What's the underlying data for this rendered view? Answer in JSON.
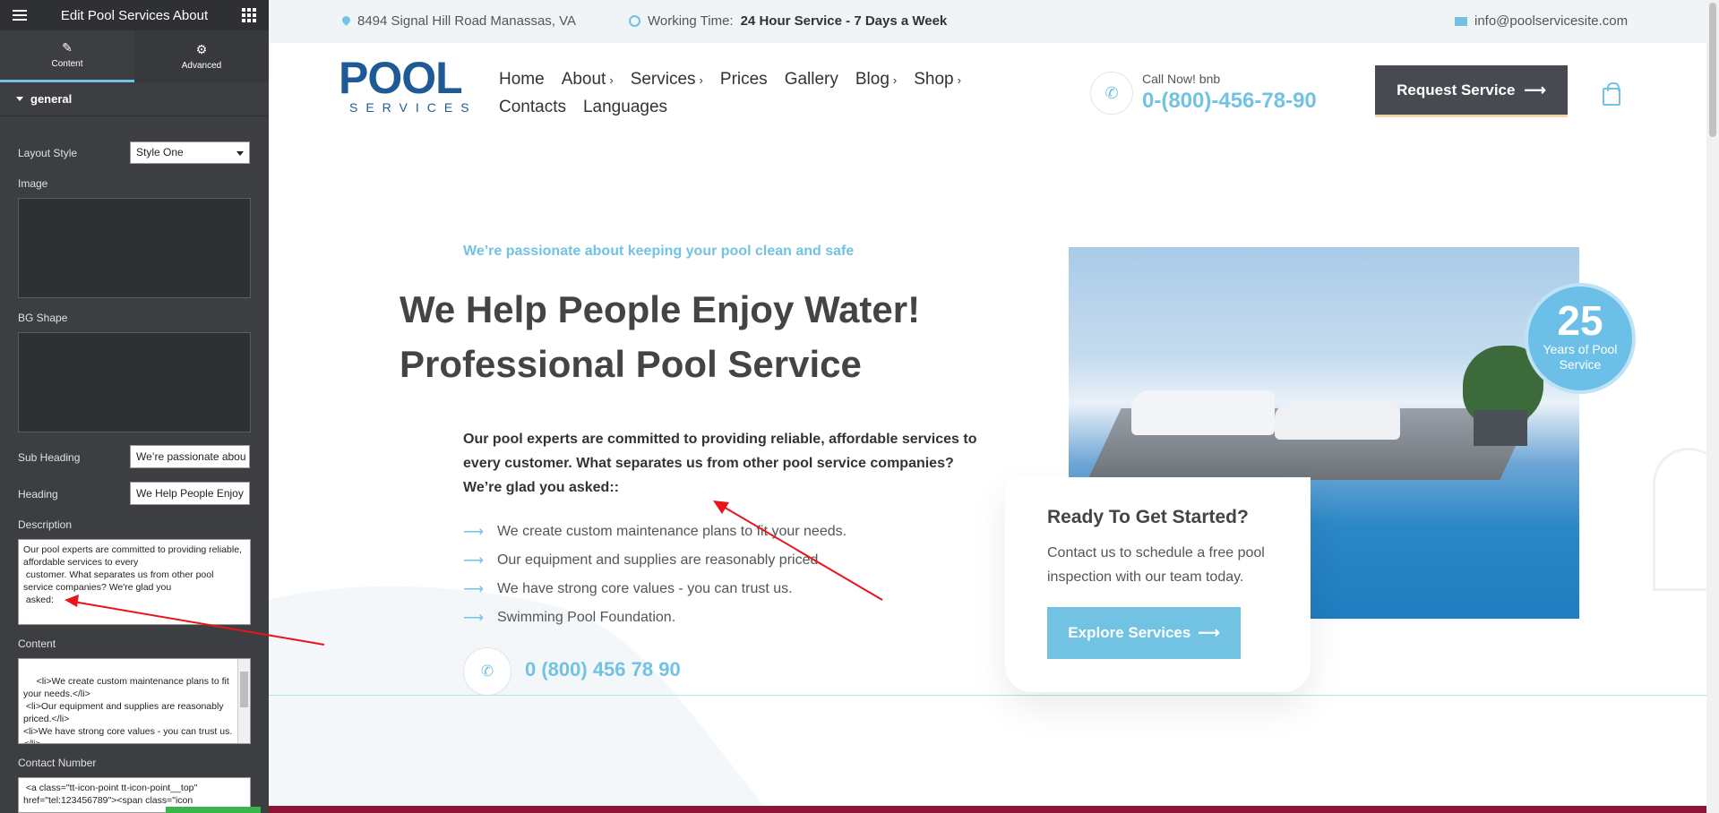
{
  "editor": {
    "title": "Edit Pool Services About",
    "tabs": [
      {
        "label": "Content",
        "icon": "pencil-icon"
      },
      {
        "label": "Advanced",
        "icon": "gear-icon"
      }
    ],
    "section": "general",
    "layout_style": {
      "label": "Layout Style",
      "value": "Style One"
    },
    "image_label": "Image",
    "bg_shape_label": "BG Shape",
    "sub_heading": {
      "label": "Sub Heading",
      "value": "We’re passionate abou"
    },
    "heading": {
      "label": "Heading",
      "value": "We Help People Enjoy"
    },
    "description": {
      "label": "Description",
      "value": "Our pool experts are committed to providing reliable, affordable services to every\n customer. What separates us from other pool service companies? We're glad you\n asked:"
    },
    "content": {
      "label": "Content",
      "value": " <li>We create custom maintenance plans to fit your needs.</li>\n <li>Our equipment and supplies are reasonably priced.</li>\n<li>We have strong core values - you can trust us.</li>\n <li>Swimming Pool Foundation.</li>"
    },
    "contact_number": {
      "label": "Contact Number",
      "value": " <a class=\"tt-icon-point tt-icon-point__top\" href=\"tel:123456789\"><span class=\"icon"
    }
  },
  "topbar": {
    "address": "8494 Signal Hill Road Manassas, VA",
    "working_label": "Working Time:",
    "working_value": "24 Hour Service - 7 Days a Week",
    "email": "info@poolservicesite.com"
  },
  "logo": {
    "main": "POOL",
    "sub": "SERVICES"
  },
  "nav": {
    "row1": [
      {
        "label": "Home",
        "chevron": ""
      },
      {
        "label": "About",
        "chevron": "›"
      },
      {
        "label": "Services",
        "chevron": "›"
      },
      {
        "label": "Prices",
        "chevron": ""
      },
      {
        "label": "Gallery",
        "chevron": ""
      },
      {
        "label": "Blog",
        "chevron": "›"
      },
      {
        "label": "Shop",
        "chevron": "›"
      }
    ],
    "row2": [
      {
        "label": "Contacts"
      },
      {
        "label": "Languages"
      }
    ]
  },
  "header_call": {
    "label": "Call Now! bnb",
    "number": "0-(800)-456-78-90"
  },
  "request_button": "Request Service",
  "hero": {
    "subheading": "We’re passionate about keeping your pool clean and safe",
    "heading_line1": "We Help People Enjoy Water!",
    "heading_line2": "Professional Pool Service",
    "description": "Our pool experts are committed to providing reliable, affordable services to every customer. What separates us from other pool service companies? We’re glad you asked::",
    "list": [
      "We create custom maintenance plans to fit your needs.",
      "Our equipment and supplies are reasonably priced.",
      "We have strong core values - you can trust us.",
      "Swimming Pool Foundation."
    ],
    "phone": "0 (800) 456 78 90"
  },
  "badge": {
    "number": "25",
    "label": "Years of Pool Service"
  },
  "card": {
    "title": "Ready To Get Started?",
    "text": "Contact us to schedule a free pool inspection with our team today.",
    "button": "Explore Services"
  },
  "colors": {
    "accent": "#72c2e4",
    "dark": "#474a51",
    "annotation": "#e8141c"
  }
}
